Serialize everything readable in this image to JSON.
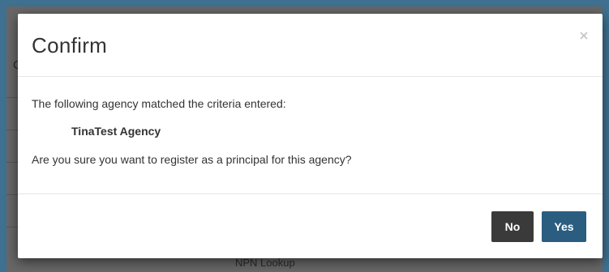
{
  "backdrop": {
    "partial_heading_letter": "C",
    "partial_label": "NPN Lookup"
  },
  "dialog": {
    "title": "Confirm",
    "close_icon": "close-icon",
    "message_intro": "The following agency matched the criteria entered:",
    "agency_name": "TinaTest Agency",
    "question": "Are you sure you want to register as a principal for this agency?",
    "buttons": {
      "no_label": "No",
      "yes_label": "Yes"
    }
  },
  "colors": {
    "page_frame": "#3f7090",
    "overlay": "#676767",
    "no_button": "#3a3a3a",
    "yes_button": "#2b5d80"
  }
}
